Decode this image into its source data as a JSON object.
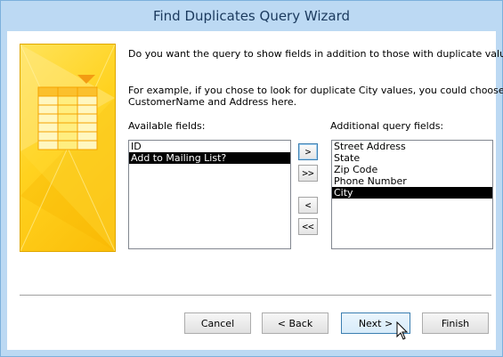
{
  "window": {
    "title": "Find Duplicates Query Wizard"
  },
  "instructions": {
    "question": "Do you want the query to show fields in addition to those with duplicate values?",
    "example_line1": "For example, if you chose to look for duplicate City values, you could choose",
    "example_line2": "CustomerName and Address here."
  },
  "available": {
    "label": "Available fields:",
    "items": [
      {
        "label": "ID",
        "selected": false
      },
      {
        "label": "Add to Mailing List?",
        "selected": true
      }
    ]
  },
  "additional": {
    "label": "Additional query fields:",
    "items": [
      {
        "label": "Street Address",
        "selected": false
      },
      {
        "label": "State",
        "selected": false
      },
      {
        "label": "Zip Code",
        "selected": false
      },
      {
        "label": "Phone Number",
        "selected": false
      },
      {
        "label": "City",
        "selected": true
      }
    ]
  },
  "move_buttons": {
    "add_one": ">",
    "add_all": ">>",
    "remove_one": "<",
    "remove_all": "<<"
  },
  "buttons": {
    "cancel": "Cancel",
    "back": "< Back",
    "next": "Next >",
    "finish": "Finish"
  },
  "colors": {
    "title_bar": "#bcd9f3",
    "art_yellow": "#ffd21f",
    "selection": "#000000"
  }
}
